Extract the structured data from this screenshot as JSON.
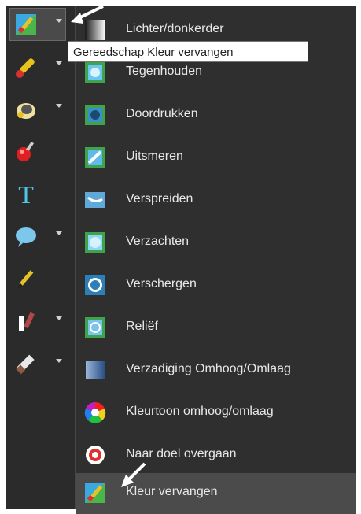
{
  "tooltip": {
    "text": "Gereedschap Kleur vervangen"
  },
  "tools": [
    {
      "name": "kleur-vervangen-tool",
      "icon": "color-replace-icon",
      "has_flyout": true,
      "active": true
    },
    {
      "name": "brush-tool",
      "icon": "brush-icon",
      "has_flyout": true
    },
    {
      "name": "fill-tool",
      "icon": "paint-bucket-icon",
      "has_flyout": true
    },
    {
      "name": "red-eye-tool",
      "icon": "red-eye-icon",
      "has_flyout": false
    },
    {
      "name": "text-tool",
      "icon": "text-icon",
      "glyph": "T",
      "has_flyout": false
    },
    {
      "name": "shape-tool",
      "icon": "speech-bubble-icon",
      "has_flyout": true
    },
    {
      "name": "pen-tool",
      "icon": "pen-icon",
      "has_flyout": false
    },
    {
      "name": "dropper-tool",
      "icon": "dropper-icon",
      "has_flyout": true
    },
    {
      "name": "eraser-tool",
      "icon": "eraser-icon",
      "has_flyout": true
    }
  ],
  "menu": {
    "items": [
      {
        "label": "Lichter/donkerder",
        "icon": "lighten-darken-icon"
      },
      {
        "label": "Tegenhouden",
        "icon": "dodge-icon"
      },
      {
        "label": "Doordrukken",
        "icon": "burn-icon"
      },
      {
        "label": "Uitsmeren",
        "icon": "smudge-icon"
      },
      {
        "label": "Verspreiden",
        "icon": "push-icon"
      },
      {
        "label": "Verzachten",
        "icon": "soften-icon"
      },
      {
        "label": "Verschergen",
        "icon": "sharpen-icon"
      },
      {
        "label": "Reliëf",
        "icon": "emboss-icon"
      },
      {
        "label": "Verzadiging Omhoog/Omlaag",
        "icon": "saturation-icon"
      },
      {
        "label": "Kleurtoon omhoog/omlaag",
        "icon": "hue-wheel-icon"
      },
      {
        "label": "Naar doel overgaan",
        "icon": "target-icon"
      },
      {
        "label": "Kleur vervangen",
        "icon": "color-replace-icon",
        "selected": true
      }
    ]
  },
  "colors": {
    "toolbar_bg": "#2b2b2b",
    "menu_bg": "#2f2f2f",
    "selected_bg": "#4b4b4b",
    "text": "#e8e8e8"
  }
}
